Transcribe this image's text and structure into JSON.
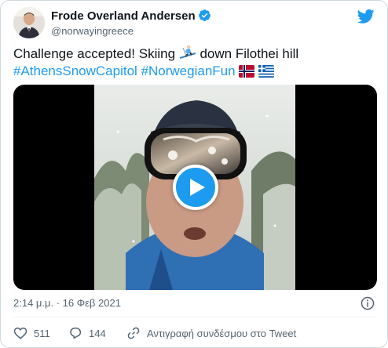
{
  "author": {
    "display_name": "Frode Overland Andersen",
    "handle": "@norwayingreece",
    "verified": true
  },
  "tweet": {
    "text_before": "Challenge accepted! Skiing ",
    "skier_emoji": "skier-emoji",
    "text_after": " down Filothei hill",
    "hashtags": [
      "#AthensSnowCapitol",
      "#NorwegianFun"
    ],
    "flags": [
      "flag-norway-emoji",
      "flag-greece-emoji"
    ]
  },
  "media": {
    "type": "video",
    "play_icon": "play-icon"
  },
  "timestamp": "2:14 μ.μ. · 16 Φεβ 2021",
  "actions": {
    "like_count": "511",
    "reply_count": "144",
    "copy_link_label": "Αντιγραφή συνδέσμου στο Tweet"
  },
  "colors": {
    "accent": "#1d9bf0",
    "text": "#0f1419",
    "secondary_text": "#536471",
    "border": "#cfd9de"
  }
}
